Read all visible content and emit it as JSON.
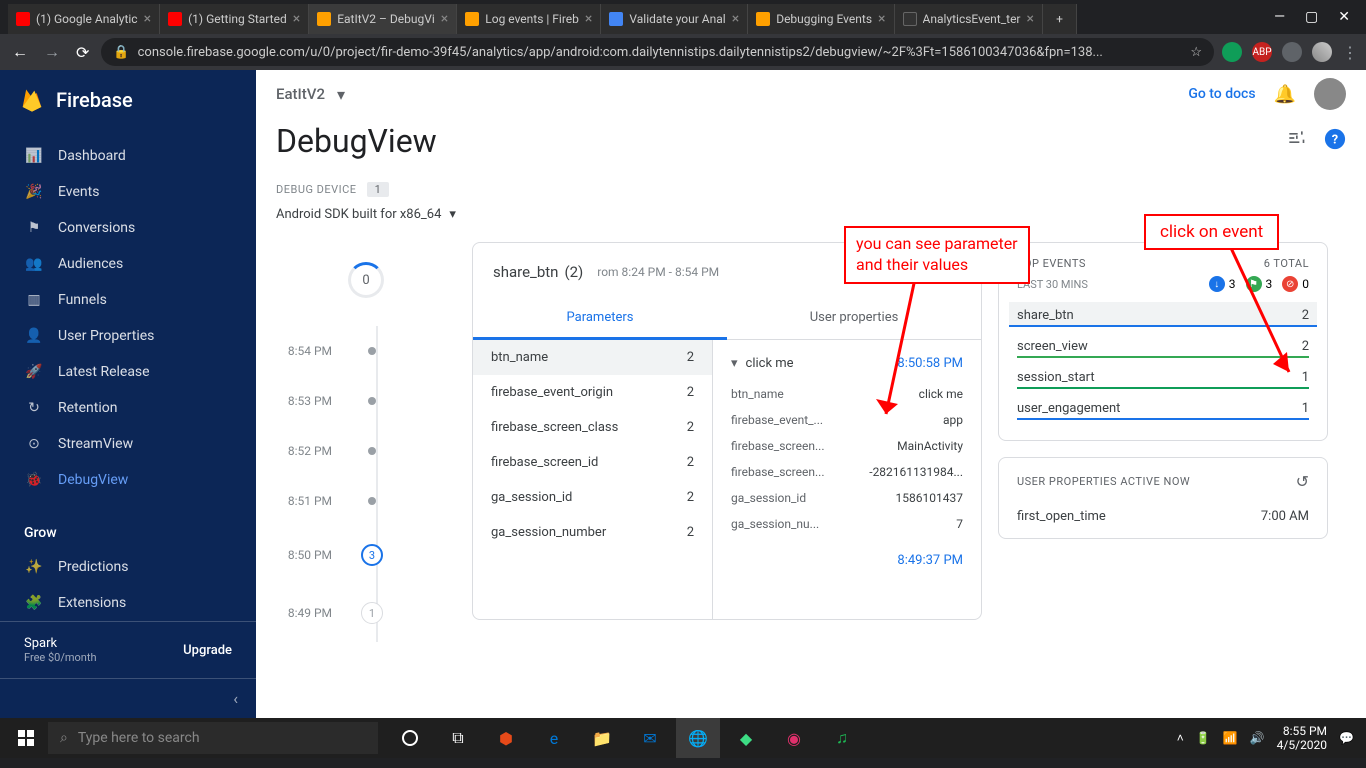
{
  "browser": {
    "tabs": [
      {
        "title": "(1) Google Analytic",
        "favicon": "fi-yt"
      },
      {
        "title": "(1) Getting Started",
        "favicon": "fi-yt"
      },
      {
        "title": "EatItV2 – DebugVi",
        "favicon": "fi-fb",
        "active": true
      },
      {
        "title": "Log events | Fireb",
        "favicon": "fi-fb"
      },
      {
        "title": "Validate your Anal",
        "favicon": "fi-g"
      },
      {
        "title": "Debugging Events",
        "favicon": "fi-fb"
      },
      {
        "title": "AnalyticsEvent_ter",
        "favicon": "fi-gh"
      }
    ],
    "url": "console.firebase.google.com/u/0/project/fir-demo-39f45/analytics/app/android:com.dailytennistips.dailytennistips2/debugview/~2F%3Ft=1586100347036&fpn=138..."
  },
  "firebase": {
    "brand": "Firebase",
    "project": "EatItV2",
    "docs": "Go to docs",
    "nav": [
      {
        "label": "Dashboard",
        "icon": "📊"
      },
      {
        "label": "Events",
        "icon": "🎉"
      },
      {
        "label": "Conversions",
        "icon": "⚑"
      },
      {
        "label": "Audiences",
        "icon": "👥"
      },
      {
        "label": "Funnels",
        "icon": "▥"
      },
      {
        "label": "User Properties",
        "icon": "👤"
      },
      {
        "label": "Latest Release",
        "icon": "🚀"
      },
      {
        "label": "Retention",
        "icon": "↻"
      },
      {
        "label": "StreamView",
        "icon": "⊙"
      },
      {
        "label": "DebugView",
        "icon": "🐞",
        "active": true
      }
    ],
    "grow_section": "Grow",
    "grow": [
      {
        "label": "Predictions",
        "icon": "✨"
      },
      {
        "label": "Extensions",
        "icon": "🧩"
      }
    ],
    "spark": {
      "name": "Spark",
      "sub": "Free $0/month",
      "action": "Upgrade"
    }
  },
  "page": {
    "title": "DebugView",
    "debug_device_label": "DEBUG DEVICE",
    "debug_device_count": "1",
    "debug_device_value": "Android SDK built for x86_64"
  },
  "timeline": {
    "counter": "0",
    "rows": [
      {
        "time": "8:54 PM",
        "type": "dot"
      },
      {
        "time": "8:53 PM",
        "type": "dot"
      },
      {
        "time": "8:52 PM",
        "type": "dot"
      },
      {
        "time": "8:51 PM",
        "type": "dot"
      },
      {
        "time": "8:50 PM",
        "type": "sel",
        "count": "3"
      },
      {
        "time": "8:49 PM",
        "type": "future",
        "count": "1"
      }
    ]
  },
  "detail": {
    "title": "share_btn",
    "count": "(2)",
    "range": "rom 8:24 PM - 8:54 PM",
    "tabs": {
      "parameters": "Parameters",
      "user_properties": "User properties"
    },
    "params": [
      {
        "name": "btn_name",
        "count": "2",
        "sel": true
      },
      {
        "name": "firebase_event_origin",
        "count": "2"
      },
      {
        "name": "firebase_screen_class",
        "count": "2"
      },
      {
        "name": "firebase_screen_id",
        "count": "2"
      },
      {
        "name": "ga_session_id",
        "count": "2"
      },
      {
        "name": "ga_session_number",
        "count": "2"
      }
    ],
    "instance": {
      "header_value": "click me",
      "header_time": "8:50:58 PM",
      "kv": [
        {
          "k": "btn_name",
          "v": "click me"
        },
        {
          "k": "firebase_event_...",
          "v": "app"
        },
        {
          "k": "firebase_screen...",
          "v": "MainActivity"
        },
        {
          "k": "firebase_screen...",
          "v": "-282161131984..."
        },
        {
          "k": "ga_session_id",
          "v": "1586101437"
        },
        {
          "k": "ga_session_nu...",
          "v": "7"
        }
      ],
      "footer_time": "8:49:37 PM"
    }
  },
  "top_events": {
    "title": "TOP EVENTS",
    "total_label": "6 TOTAL",
    "subtitle": "LAST 30 MINS",
    "chips": [
      {
        "color": "d-blue",
        "glyph": "↓",
        "count": "3"
      },
      {
        "color": "d-green",
        "glyph": "⚑",
        "count": "3"
      },
      {
        "color": "d-red",
        "glyph": "⊘",
        "count": "0"
      }
    ],
    "events": [
      {
        "name": "share_btn",
        "count": "2",
        "border": "b-blue",
        "sel": true
      },
      {
        "name": "screen_view",
        "count": "2",
        "border": "b-green"
      },
      {
        "name": "session_start",
        "count": "1",
        "border": "b-teal"
      },
      {
        "name": "user_engagement",
        "count": "1",
        "border": "b-blue"
      }
    ]
  },
  "user_props": {
    "title": "USER PROPERTIES ACTIVE NOW",
    "rows": [
      {
        "name": "first_open_time",
        "value": "7:00 AM"
      }
    ]
  },
  "annotations": {
    "a1_l1": "you can see parameter",
    "a1_l2": "and their values",
    "a2": "click on event"
  },
  "taskbar": {
    "search_placeholder": "Type here to search",
    "time": "8:55 PM",
    "date": "4/5/2020"
  }
}
